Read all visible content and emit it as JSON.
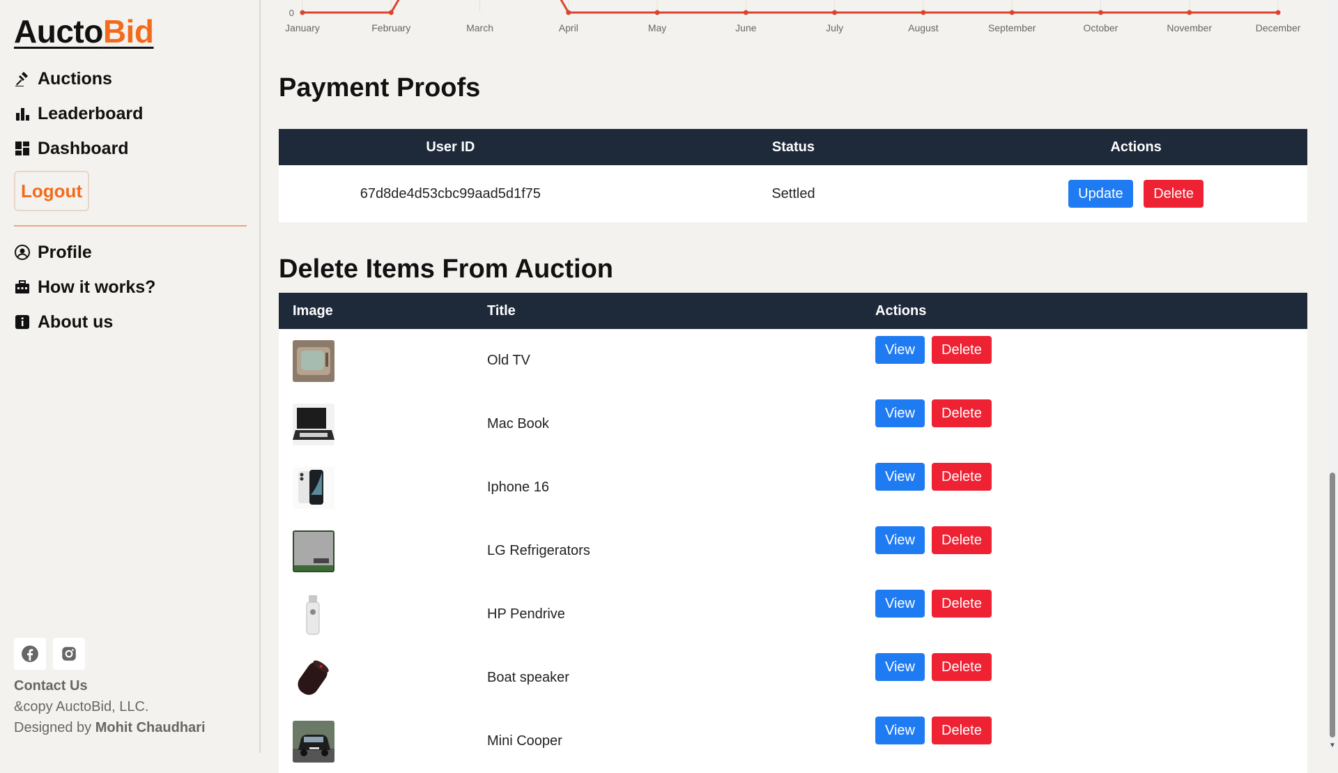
{
  "brand": {
    "part1": "Aucto",
    "part2": "Bid",
    "accent_color": "#f26b1d"
  },
  "nav": [
    {
      "label": "Auctions",
      "icon": "gavel-icon"
    },
    {
      "label": "Leaderboard",
      "icon": "bar-chart-icon"
    },
    {
      "label": "Dashboard",
      "icon": "dashboard-icon"
    }
  ],
  "logout_label": "Logout",
  "nav_secondary": [
    {
      "label": "Profile",
      "icon": "user-circle-icon"
    },
    {
      "label": "How it works?",
      "icon": "briefcase-icon"
    },
    {
      "label": "About us",
      "icon": "info-icon"
    }
  ],
  "socials": [
    {
      "icon": "facebook-icon"
    },
    {
      "icon": "instagram-icon"
    }
  ],
  "footer": {
    "contact": "Contact Us",
    "copyright": "&copy AuctoBid, LLC.",
    "designed_prefix": "Designed by",
    "designer": "Mohit Chaudhari"
  },
  "chart_data": {
    "type": "line",
    "categories": [
      "January",
      "February",
      "March",
      "April",
      "May",
      "June",
      "July",
      "August",
      "September",
      "October",
      "November",
      "December"
    ],
    "series": [
      {
        "values": [
          0,
          0,
          null,
          0,
          0,
          0,
          0,
          0,
          0,
          0,
          0,
          0
        ]
      }
    ],
    "y_tick_visible": "0",
    "line_color": "#d9442f",
    "grid": true
  },
  "payment_proofs": {
    "title": "Payment Proofs",
    "columns": [
      "User ID",
      "Status",
      "Actions"
    ],
    "rows": [
      {
        "user_id": "67d8de4d53cbc99aad5d1f75",
        "status": "Settled"
      }
    ],
    "update_label": "Update",
    "delete_label": "Delete"
  },
  "delete_items": {
    "title": "Delete Items From Auction",
    "columns": [
      "Image",
      "Title",
      "Actions"
    ],
    "view_label": "View",
    "delete_label": "Delete",
    "rows": [
      {
        "title": "Old TV",
        "thumb": "tv"
      },
      {
        "title": "Mac Book",
        "thumb": "laptop"
      },
      {
        "title": "Iphone 16",
        "thumb": "phone"
      },
      {
        "title": "LG Refrigerators",
        "thumb": "fridge"
      },
      {
        "title": "HP Pendrive",
        "thumb": "pendrive"
      },
      {
        "title": "Boat speaker",
        "thumb": "speaker"
      },
      {
        "title": "Mini Cooper",
        "thumb": "car"
      }
    ]
  },
  "colors": {
    "header_bg": "#1e2a3a",
    "primary": "#1f7bf2",
    "danger": "#ee2233"
  }
}
